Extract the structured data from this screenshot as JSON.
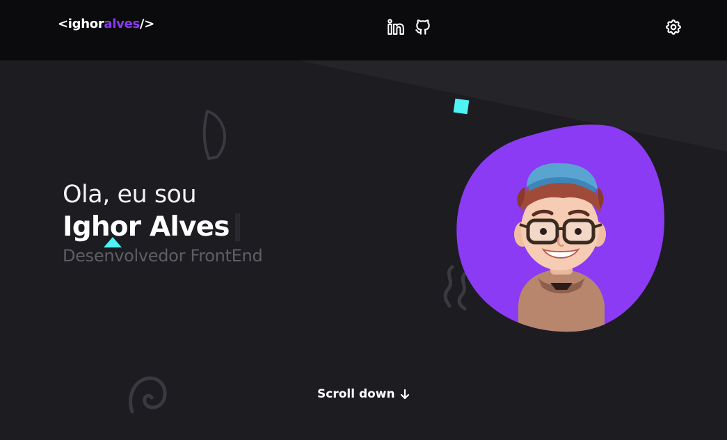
{
  "header": {
    "logo": {
      "open": "<",
      "first": "ighor",
      "accent": "alves",
      "close": "/>"
    },
    "social_icons": [
      "linkedin-icon",
      "github-icon"
    ],
    "settings_icon": "gear-icon"
  },
  "hero": {
    "greeting": "Ola, eu sou",
    "name": "Ighor Alves",
    "role": "Desenvolvedor FrontEnd"
  },
  "scroll": {
    "label": "Scroll down",
    "icon": "arrow-down-icon"
  },
  "colors": {
    "accent": "#8b3bf3",
    "cyan": "#4ef3f5",
    "background": "#1d1c21",
    "header": "#0b0b0d"
  }
}
